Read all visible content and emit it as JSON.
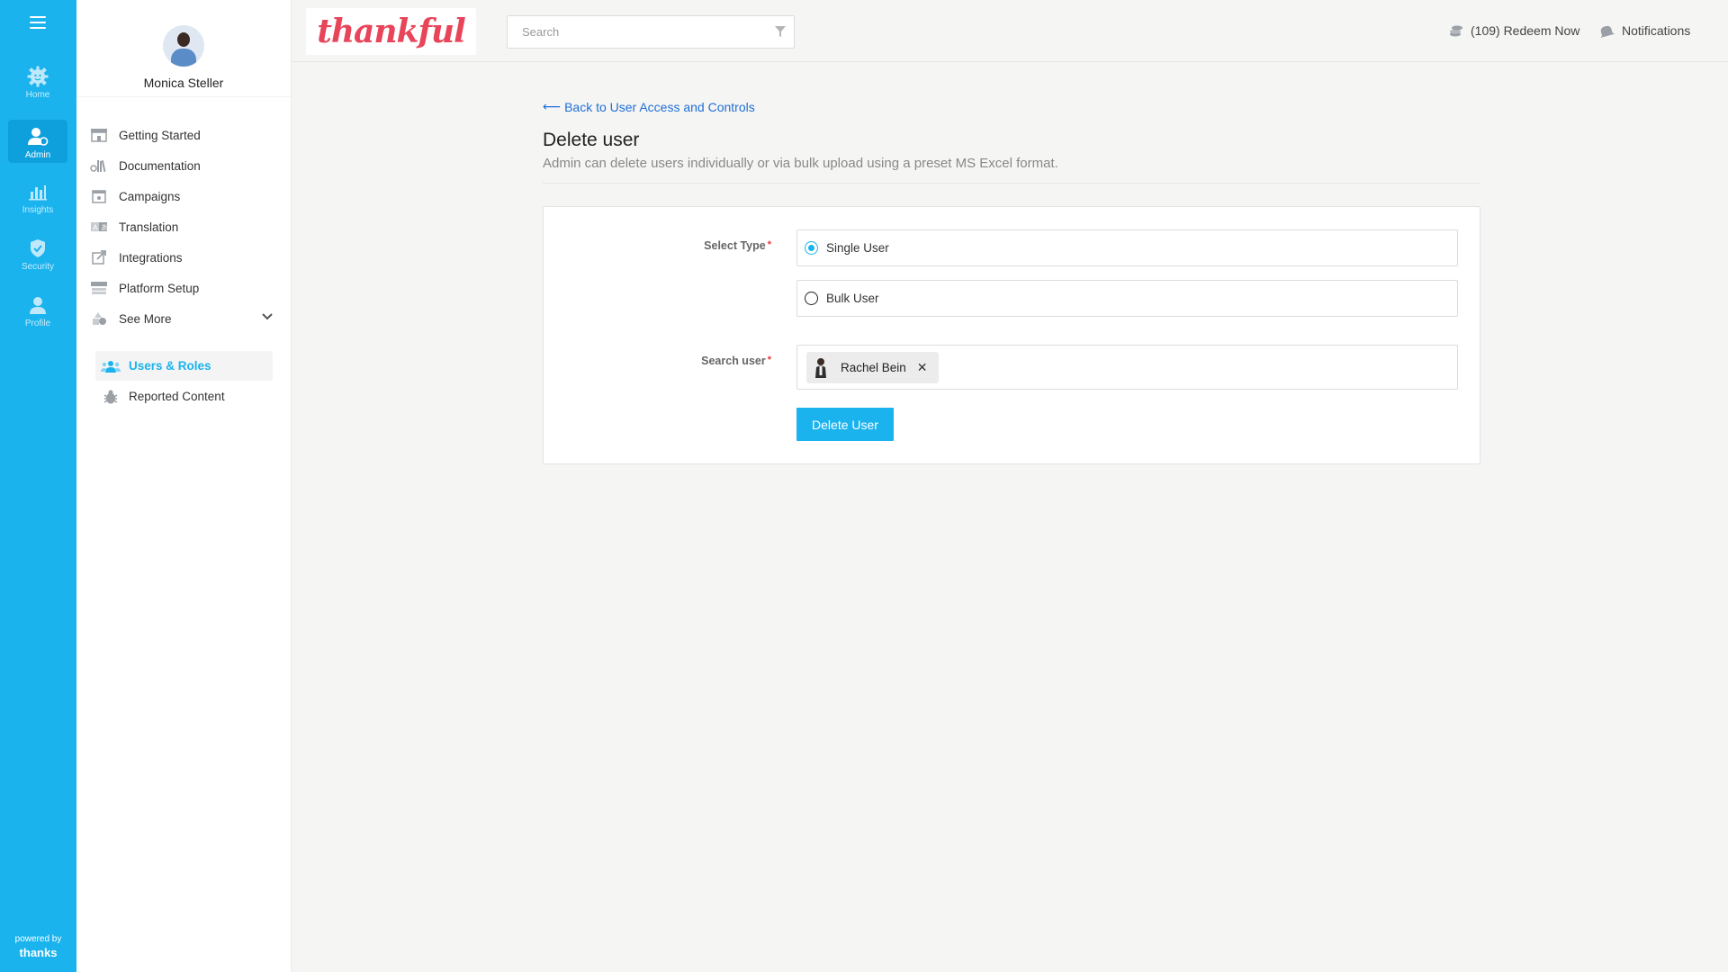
{
  "rail": {
    "items": [
      {
        "label": "Home",
        "icon": "home-gear-icon"
      },
      {
        "label": "Admin",
        "icon": "admin-user-icon",
        "active": true
      },
      {
        "label": "Insights",
        "icon": "bar-chart-icon"
      },
      {
        "label": "Security",
        "icon": "shield-check-icon"
      },
      {
        "label": "Profile",
        "icon": "person-icon"
      }
    ],
    "powered_by": "powered by",
    "powered_brand": "thanks"
  },
  "profile": {
    "name": "Monica Steller"
  },
  "menu": {
    "items": [
      {
        "label": "Getting Started",
        "icon": "storefront-icon"
      },
      {
        "label": "Documentation",
        "icon": "books-icon"
      },
      {
        "label": "Campaigns",
        "icon": "calendar-icon"
      },
      {
        "label": "Translation",
        "icon": "translate-icon"
      },
      {
        "label": "Integrations",
        "icon": "external-link-icon"
      },
      {
        "label": "Platform Setup",
        "icon": "setup-icon"
      },
      {
        "label": "See More",
        "icon": "shapes-icon"
      }
    ],
    "submenu": [
      {
        "label": "Users & Roles",
        "icon": "users-group-icon",
        "active": true
      },
      {
        "label": "Reported Content",
        "icon": "bug-icon"
      }
    ]
  },
  "topbar": {
    "logo": "thankful",
    "search_placeholder": "Search",
    "redeem_label": "(109) Redeem Now",
    "notifications_label": "Notifications"
  },
  "main": {
    "back_link": "Back to User Access and Controls",
    "title": "Delete user",
    "description": "Admin can delete users individually or via bulk upload using a preset MS Excel format.",
    "select_type_label": "Select Type",
    "options": [
      {
        "label": "Single User",
        "checked": true
      },
      {
        "label": "Bulk User",
        "checked": false
      }
    ],
    "search_user_label": "Search user",
    "selected_user": "Rachel Bein",
    "delete_button": "Delete User"
  },
  "colors": {
    "accent": "#1ab3ee",
    "link": "#1f6fd6",
    "brand_logo": "#e8455a",
    "required": "#e53935"
  }
}
